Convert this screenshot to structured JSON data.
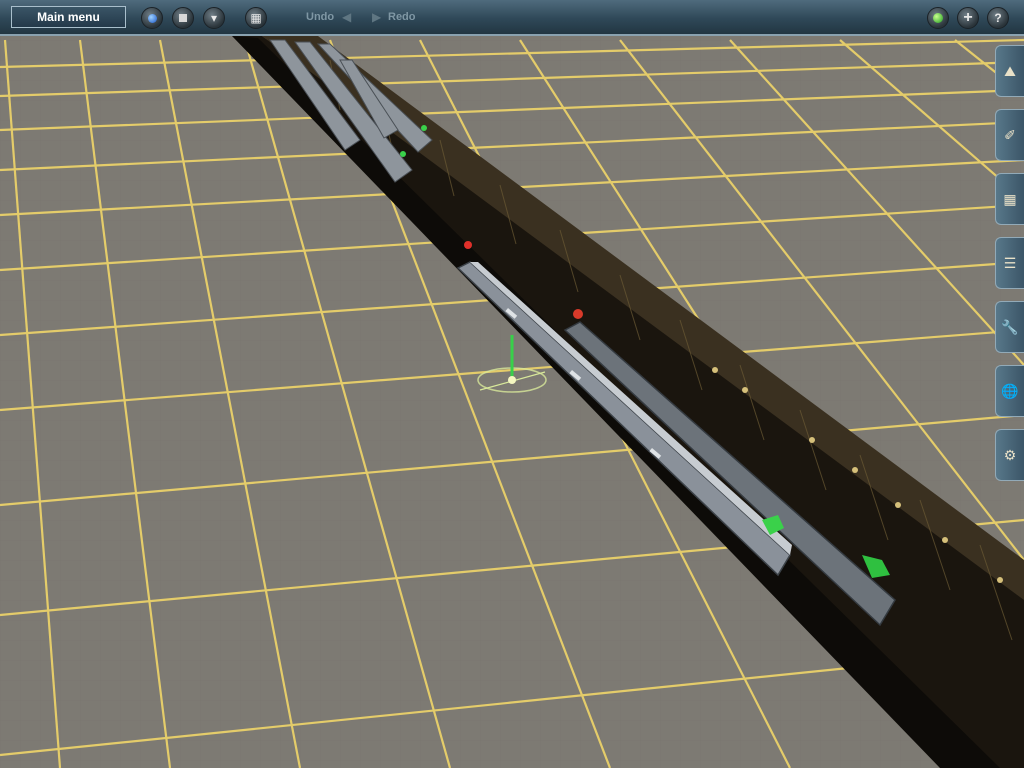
{
  "toolbar": {
    "main_menu_label": "Main menu",
    "undo_label": "Undo",
    "redo_label": "Redo"
  },
  "icons": {
    "left_buttons": [
      "blue-orb-icon",
      "stop-icon",
      "filter-icon",
      "grid-icon"
    ],
    "right_buttons": [
      "green-orb-icon",
      "plus-icon",
      "help-icon"
    ],
    "side_tabs": [
      "terrain-icon",
      "paint-icon",
      "object-icon",
      "track-icon",
      "wrench-icon",
      "globe-icon",
      "settings-icon"
    ]
  },
  "colors": {
    "ground": "#7d7a73",
    "grid_line": "#f0d56a",
    "toolbar": "#2f4858",
    "train_body": "#7f868e"
  }
}
